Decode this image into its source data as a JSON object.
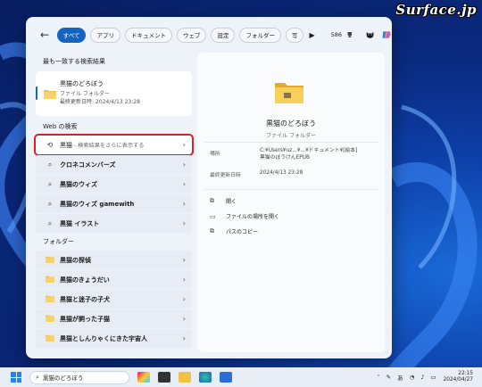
{
  "watermark": "Surface.jp",
  "topbar": {
    "tabs": [
      "すべて",
      "アプリ",
      "ドキュメント",
      "ウェブ",
      "設定",
      "フォルダー",
      "写"
    ],
    "points": "586"
  },
  "best_match": {
    "header": "最も一致する検索結果",
    "title": "黒猫のどろぼう",
    "type": "ファイル フォルダー",
    "modified": "最終更新日時: 2024/4/13 23:28"
  },
  "web": {
    "header": "Web の検索",
    "items": [
      {
        "main": "黒猫",
        "sub": " - 検索結果をさらに表示する",
        "icon": "history-icon"
      },
      {
        "main": "クロネコメンバーズ",
        "sub": "",
        "icon": "search-icon"
      },
      {
        "main": "黒猫のウィズ",
        "sub": "",
        "icon": "search-icon"
      },
      {
        "main": "黒猫のウィズ gamewith",
        "sub": "",
        "icon": "search-icon"
      },
      {
        "main": "黒猫 イラスト",
        "sub": "",
        "icon": "search-icon"
      }
    ]
  },
  "folders": {
    "header": "フォルダー",
    "items": [
      "黒猫の探偵",
      "黒猫のきょうだい",
      "黒猫と迷子の子犬",
      "黒猫が飼った子猫",
      "黒猫としんりゃくにきた宇宙人"
    ]
  },
  "detail": {
    "title": "黒猫のどろぼう",
    "subtitle": "ファイル フォルダー",
    "location_label": "場所",
    "location_value_1": "C:¥Users¥uz...¥...¥ドキュメント¥[絵本]",
    "location_value_2": "黒猫のぼうけんEPUB",
    "modified_label": "最終更新日時",
    "modified_value": "2024/4/13 23:28",
    "actions": [
      {
        "label": "開く",
        "icon": "open-icon"
      },
      {
        "label": "ファイルの場所を開く",
        "icon": "folder-open-icon"
      },
      {
        "label": "パスのコピー",
        "icon": "copy-icon"
      }
    ]
  },
  "taskbar": {
    "search_text": "黒猫のどろぼう",
    "ime": "あ",
    "time": "22:15",
    "date": "2024/04/27"
  },
  "colors": {
    "accent": "#1565c0",
    "highlight": "#e01e25",
    "folder": "#f4c242"
  }
}
